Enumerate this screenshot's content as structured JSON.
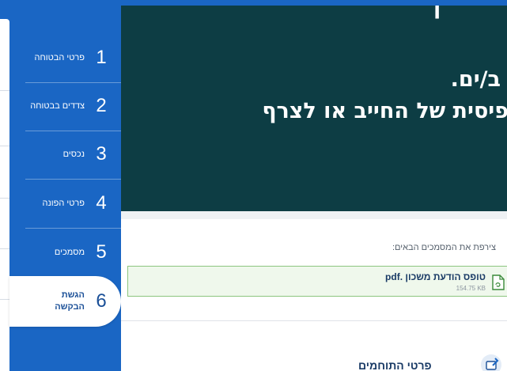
{
  "steps": [
    {
      "number": "1",
      "label": "פרטי הבטוחה"
    },
    {
      "number": "2",
      "label": "צדדים בבטוחה"
    },
    {
      "number": "3",
      "label": "נכסים"
    },
    {
      "number": "4",
      "label": "פרטי הפונה"
    },
    {
      "number": "5",
      "label": "מסמכים"
    },
    {
      "number": "6",
      "label": "הגשת הבקשה",
      "active": true
    }
  ],
  "hero": {
    "line1": "ב/ים.",
    "line2": "פיסית של החייב או לצרף"
  },
  "documents": {
    "label": "צירפת את המסמכים הבאים:",
    "items": [
      {
        "name": "טופס הודעת משכון .pdf",
        "size": "154.75 KB",
        "icon": "pdf-file-icon"
      }
    ]
  },
  "section": {
    "title": "פרטי התוחמים",
    "icon": "attachment-icon"
  },
  "colors": {
    "sidebar": "#1a66c4",
    "hero": "#0d3d44",
    "active_text": "#1a4f97",
    "doc_border": "#8cc67f"
  }
}
